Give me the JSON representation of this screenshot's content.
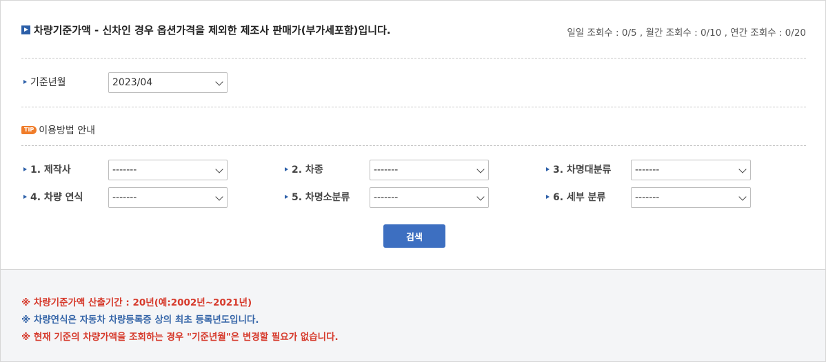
{
  "header": {
    "title": "차량기준가액 - 신차인 경우 옵션가격을 제외한 제조사 판매가(부가세포함)입니다.",
    "counts": "일일 조회수 : 0/5 , 월간 조회수 : 0/10 , 연간 조회수 : 0/20"
  },
  "base_month": {
    "label": "기준년월",
    "value": "2023/04"
  },
  "tip": {
    "badge": "TIP",
    "label": "이용방법 안내"
  },
  "filters": [
    {
      "label": "1. 제작사",
      "value": "-------"
    },
    {
      "label": "2. 차종",
      "value": "-------"
    },
    {
      "label": "3. 차명대분류",
      "value": "-------"
    },
    {
      "label": "4. 차량 연식",
      "value": "-------"
    },
    {
      "label": "5. 차명소분류",
      "value": "-------"
    },
    {
      "label": "6. 세부 분류",
      "value": "-------"
    }
  ],
  "search_label": "검색",
  "notes": [
    "※ 차량기준가액 산출기간 : 20년(예:2002년~2021년)",
    "※ 차량연식은 자동차 차량등록증 상의 최초 등록년도입니다.",
    "※ 현재 기준의 차량가액을 조회하는 경우 \"기준년월\"은 변경할 필요가 없습니다."
  ],
  "colors": {
    "accent": "#3d6fc1",
    "note_red": "#d63a2c",
    "note_blue": "#3565a8",
    "tip_badge": "#f07d2a"
  }
}
